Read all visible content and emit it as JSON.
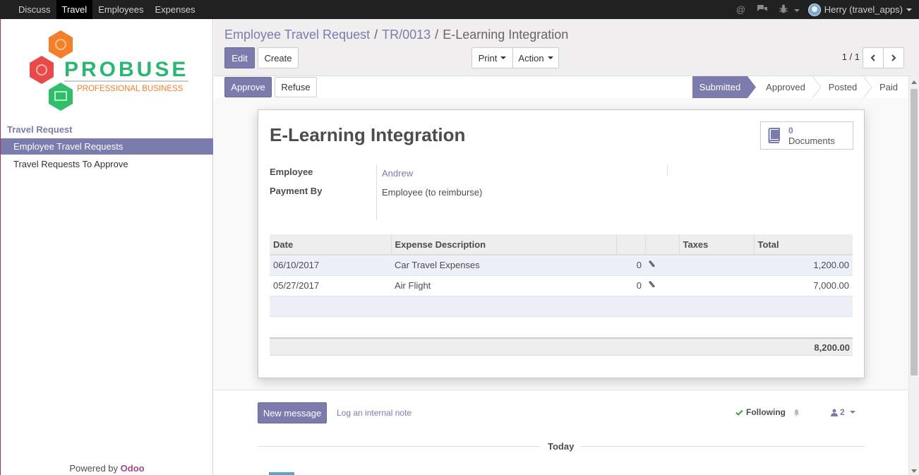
{
  "topbar": {
    "menu": [
      "Discuss",
      "Travel",
      "Employees",
      "Expenses"
    ],
    "active_index": 1,
    "icons": [
      "at-sign-icon",
      "chat-bubbles-icon",
      "bug-icon"
    ],
    "user": "Herry (travel_apps)"
  },
  "sidebar": {
    "logo_text": "PROBUSE",
    "logo_subtext": "PROFESSIONAL BUSINESS",
    "section": "Travel Request",
    "items": [
      "Employee Travel Requests",
      "Travel Requests To Approve"
    ],
    "active_index": 0,
    "powered_prefix": "Powered by",
    "powered_brand": "Odoo"
  },
  "breadcrumb": {
    "root": "Employee Travel Request",
    "ref": "TR/0013",
    "current": "E-Learning Integration",
    "sep": "/"
  },
  "toolbar": {
    "edit": "Edit",
    "create": "Create",
    "print": "Print",
    "action": "Action",
    "pager": "1 / 1"
  },
  "workflow": {
    "approve": "Approve",
    "refuse": "Refuse",
    "stages": [
      "Submitted",
      "Approved",
      "Posted",
      "Paid"
    ],
    "current_index": 0
  },
  "sheet": {
    "title": "E-Learning Integration",
    "documents_count": "0",
    "documents_label": "Documents",
    "employee_label": "Employee",
    "employee_value": "Andrew",
    "payment_label": "Payment By",
    "payment_value": "Employee (to reimburse)"
  },
  "lines": {
    "headers": [
      "Date",
      "Expense Description",
      "",
      "",
      "Taxes",
      "Total"
    ],
    "rows": [
      {
        "date": "06/10/2017",
        "desc": "Car Travel Expenses",
        "qty": "0",
        "total": "1,200.00"
      },
      {
        "date": "05/27/2017",
        "desc": "Air Flight",
        "qty": "0",
        "total": "7,000.00"
      }
    ],
    "grand_total": "8,200.00"
  },
  "chatter": {
    "new_message": "New message",
    "log_note": "Log an internal note",
    "following": "Following",
    "followers": "2",
    "today": "Today"
  },
  "colors": {
    "primary": "#7c7bad",
    "topbar": "#212121",
    "odoo": "#a24689"
  }
}
